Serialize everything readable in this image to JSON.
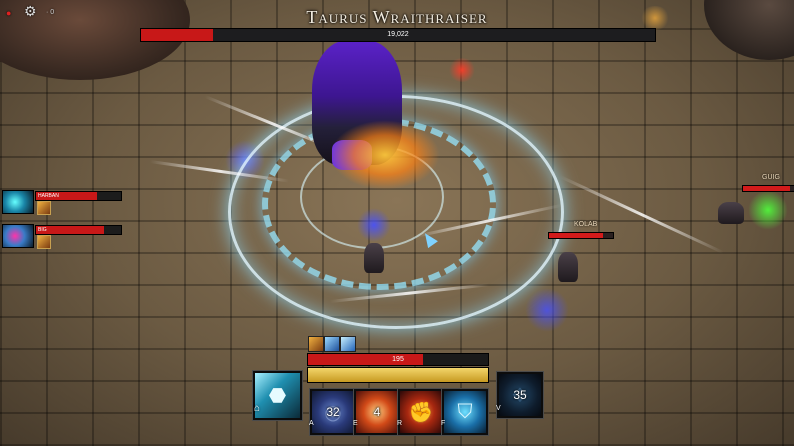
{
  "boss": {
    "name": "Taurus Wraithraiser",
    "hp_text": "19,022",
    "hp_fraction": 0.14
  },
  "top_left": {
    "record_icon": "record-dot-icon",
    "settings_icon": "gear-icon",
    "net_text": "· 0"
  },
  "party": [
    {
      "name": "HARBAN",
      "hp_fraction": 0.72,
      "portrait_icon": "ice-hero-portrait",
      "buff_icon": "claw-buff-icon"
    },
    {
      "name": "BIG",
      "hp_fraction": 0.8,
      "portrait_icon": "frost-hero-portrait",
      "buff_icon": "claw-buff-icon"
    }
  ],
  "world_units": [
    {
      "name": "KOLAB",
      "hp_fraction": 0.85
    },
    {
      "name": "GUIG",
      "hp_fraction": 0.9
    }
  ],
  "player": {
    "hp_text": "195",
    "hp_fraction": 0.64,
    "resource_fraction": 1.0,
    "buffs": [
      "claw-buff-icon",
      "frost-buff-icon",
      "ice-shard-buff-icon"
    ]
  },
  "abilities": [
    {
      "key": "",
      "cooldown": "",
      "icon": "ice-blade-icon",
      "kind": "mouse"
    },
    {
      "key": "A",
      "cooldown": "32",
      "icon": "ice-vortex-icon"
    },
    {
      "key": "E",
      "cooldown": "4",
      "icon": "fire-slash-icon"
    },
    {
      "key": "R",
      "cooldown": "",
      "icon": "flame-fist-icon"
    },
    {
      "key": "F",
      "cooldown": "",
      "icon": "ice-shield-icon"
    },
    {
      "key": "V",
      "cooldown": "35",
      "icon": "ultimate-icon"
    }
  ],
  "colors": {
    "health": "#c81818",
    "resource": "#e2b944",
    "frost": "#7fd2ff"
  }
}
